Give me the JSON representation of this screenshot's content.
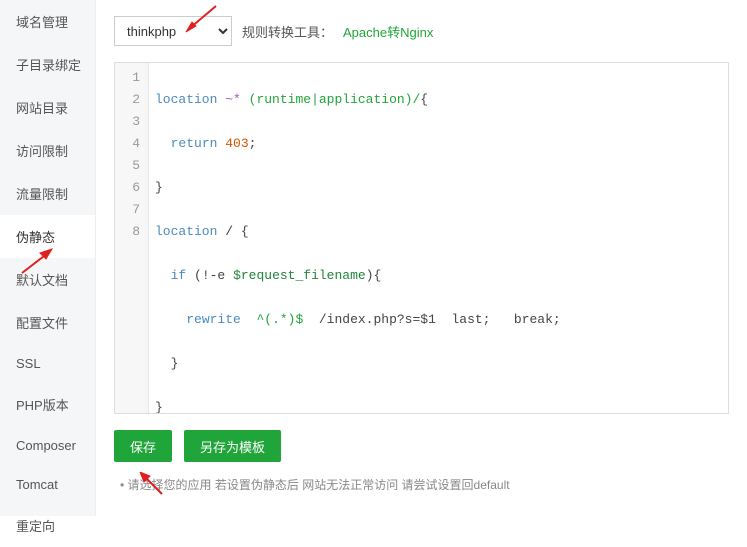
{
  "sidebar": {
    "items": [
      {
        "label": "域名管理"
      },
      {
        "label": "子目录绑定"
      },
      {
        "label": "网站目录"
      },
      {
        "label": "访问限制"
      },
      {
        "label": "流量限制"
      },
      {
        "label": "伪静态"
      },
      {
        "label": "默认文档"
      },
      {
        "label": "配置文件"
      },
      {
        "label": "SSL"
      },
      {
        "label": "PHP版本"
      },
      {
        "label": "Composer"
      },
      {
        "label": "Tomcat"
      },
      {
        "label": "重定向"
      }
    ],
    "active_index": 5
  },
  "top": {
    "select_value": "thinkphp",
    "convert_label": "规则转换工具：",
    "convert_link_text": "Apache转Nginx"
  },
  "editor": {
    "line_numbers": [
      "1",
      "2",
      "3",
      "4",
      "5",
      "6",
      "7",
      "8"
    ],
    "l1_location": "location",
    "l1_op": "~*",
    "l1_regex": "(runtime|application)/",
    "l1_brace": "{",
    "l2_return": "return",
    "l2_code": "403",
    "l2_semi": ";",
    "l3_brace": "}",
    "l4_location": "location",
    "l4_slash": "/",
    "l4_brace": "{",
    "l5_if": "if",
    "l5_open": "(!-e",
    "l5_var": "$request_filename",
    "l5_close": "){",
    "l6_rewrite": "rewrite",
    "l6_pat": "^(.*)$",
    "l6_mid": "/index.php?s=$1  last;   break",
    "l6_semi": ";",
    "l7_brace": "}",
    "l8_brace": "}"
  },
  "buttons": {
    "save": "保存",
    "save_template": "另存为模板"
  },
  "hint": "请选择您的应用   若设置伪静态后   网站无法正常访问   请尝试设置回default"
}
